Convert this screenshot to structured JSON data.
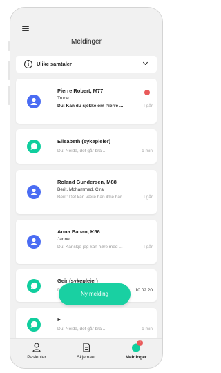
{
  "header": {
    "title": "Meldinger",
    "menu_icon": "hamburger-icon"
  },
  "filter": {
    "label": "Ulike samtaler",
    "icon": "info-icon",
    "dropdown_icon": "chevron-down-icon"
  },
  "conversations": [
    {
      "name": "Pierre Robert, M77",
      "participants": "Trude",
      "preview": "Du: Kan du sjekke om Pierre ...",
      "time": "I går",
      "unread": true,
      "avatar": "person-icon",
      "avatar_color": "#4a6cf3"
    },
    {
      "name": "Elisabeth (sykepleier)",
      "participants": "",
      "preview": "Du: Neida, det går bra ...",
      "time": "1 min",
      "unread": false,
      "avatar": "chat-bubble-icon",
      "avatar_color": "#10ce9e"
    },
    {
      "name": "Roland Gundersen, M88",
      "participants": "Berit, Mohammed, Cira",
      "preview": "Berit: Det kan være han ikke har ...",
      "time": "I går",
      "unread": false,
      "avatar": "person-icon",
      "avatar_color": "#4a6cf3"
    },
    {
      "name": "Anna Banan, K56",
      "participants": "Janne",
      "preview": "Du: Kanskje jeg kan høre med ...",
      "time": "I går",
      "unread": false,
      "avatar": "person-icon",
      "avatar_color": "#4a6cf3"
    },
    {
      "name": "Geir (sykepleier)",
      "participants": "",
      "preview": "Du: Neida, det går bra ...",
      "time": "10.02.20",
      "unread": false,
      "avatar": "chat-bubble-icon",
      "avatar_color": "#10ce9e"
    },
    {
      "name": "E",
      "participants": "",
      "preview": "Du: Neida, det går bra ...",
      "time": "1 min",
      "unread": false,
      "avatar": "chat-bubble-icon",
      "avatar_color": "#10ce9e"
    }
  ],
  "fab": {
    "label": "Ny melding"
  },
  "tabs": [
    {
      "label": "Pasienter",
      "icon": "person-outline-icon",
      "active": false
    },
    {
      "label": "Skjemaer",
      "icon": "document-icon",
      "active": false
    },
    {
      "label": "Meldinger",
      "icon": "chat-icon",
      "active": true,
      "badge": "1"
    }
  ],
  "colors": {
    "accent": "#19d0a2",
    "blue": "#4a6cf3",
    "unread": "#e95a5a"
  }
}
